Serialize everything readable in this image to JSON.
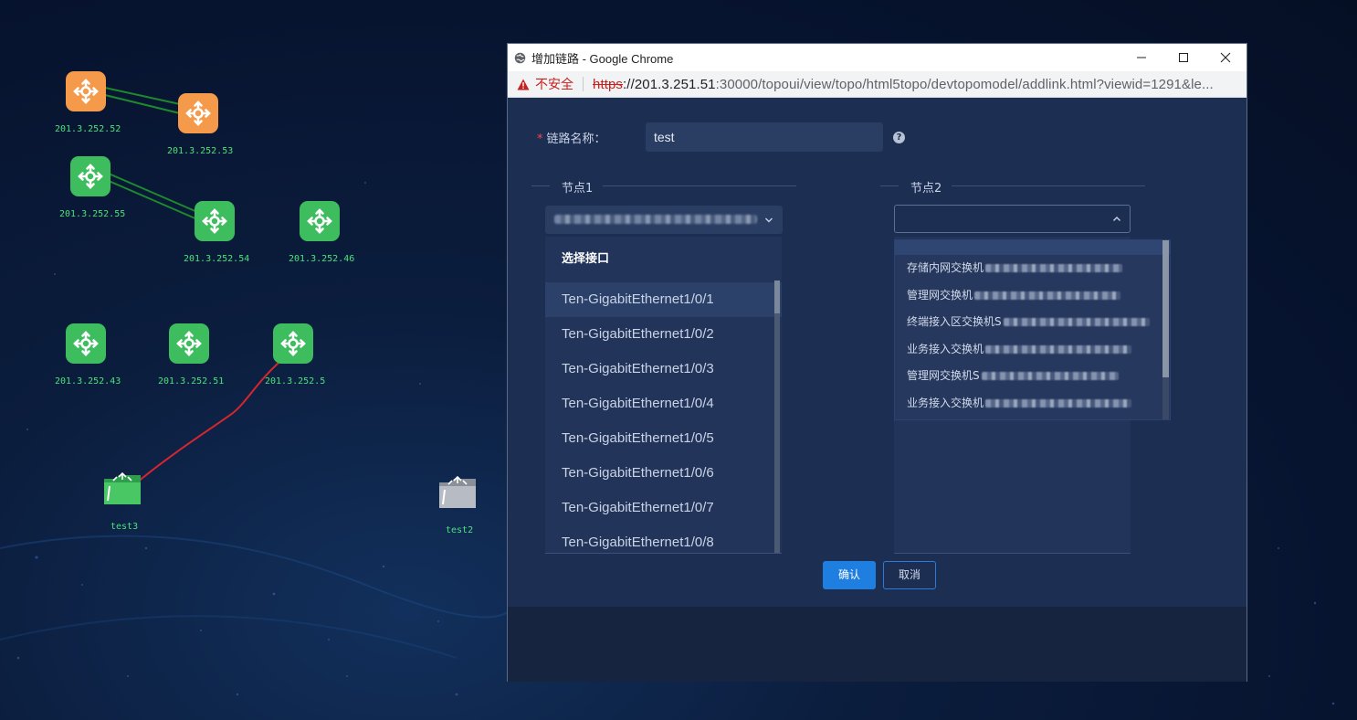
{
  "topology": {
    "nodes": [
      {
        "label": "201.3.252.52",
        "color": "#f5994a"
      },
      {
        "label": "201.3.252.53",
        "color": "#f5994a"
      },
      {
        "label": "201.3.252.55",
        "color": "#3dbd5e"
      },
      {
        "label": "201.3.252.54",
        "color": "#3dbd5e"
      },
      {
        "label": "201.3.252.46",
        "color": "#3dbd5e"
      },
      {
        "label": "201.3.252.43",
        "color": "#3dbd5e"
      },
      {
        "label": "201.3.252.51",
        "color": "#3dbd5e"
      },
      {
        "label": "201.3.252.5",
        "color": "#3dbd5e"
      }
    ],
    "groups": [
      {
        "label": "test3",
        "color": "#3dbd5e"
      },
      {
        "label": "test2",
        "color": "#b7bcc4"
      }
    ],
    "link_colors": {
      "normal": "#1e8a2c",
      "fault": "#d7262d"
    }
  },
  "browser": {
    "title": "增加链路 - Google Chrome",
    "insecure_label": "不安全",
    "url_scheme": "https",
    "url_host": "://201.3.251.51",
    "url_rest": ":30000/topoui/view/topo/html5topo/devtopomodel/addlink.html?viewid=1291&le..."
  },
  "form": {
    "name_label": "链路名称：",
    "name_value": "test",
    "help_icon": "?",
    "node1_label": "节点1",
    "node2_label": "节点2",
    "node1_dropdown": {
      "header": "选择接口",
      "items": [
        "Ten-GigabitEthernet1/0/1",
        "Ten-GigabitEthernet1/0/2",
        "Ten-GigabitEthernet1/0/3",
        "Ten-GigabitEthernet1/0/4",
        "Ten-GigabitEthernet1/0/5",
        "Ten-GigabitEthernet1/0/6",
        "Ten-GigabitEthernet1/0/7",
        "Ten-GigabitEthernet1/0/8"
      ]
    },
    "node2_dropdown": {
      "items": [
        "存储内网交换机",
        "管理网交换机",
        "终端接入区交换机S",
        "业务接入交换机",
        "管理网交换机S",
        "业务接入交换机"
      ]
    },
    "ok_label": "确认",
    "cancel_label": "取消"
  }
}
